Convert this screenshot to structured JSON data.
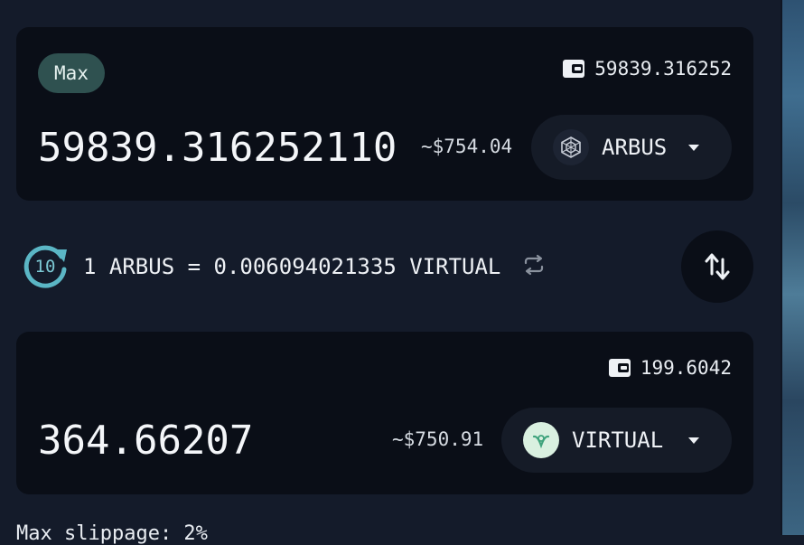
{
  "from": {
    "max_label": "Max",
    "balance": "59839.316252",
    "amount": "59839.316252110",
    "usd_value": "~$754.04",
    "token": "ARBUS",
    "token_icon": "arbus-logo-icon"
  },
  "rate": {
    "refresh_count": "10",
    "text": "1 ARBUS = 0.006094021335 VIRTUAL"
  },
  "to": {
    "balance": "199.6042",
    "amount": "364.66207",
    "usd_value": "~$750.91",
    "token": "VIRTUAL",
    "token_icon": "virtual-logo-icon"
  },
  "footer": {
    "slippage_text": "Max slippage: 2%"
  },
  "colors": {
    "page_bg": "#141b2a",
    "panel_bg": "#0a0e17",
    "max_button_bg": "#2f5150",
    "refresh_accent": "#5bb6c5"
  }
}
